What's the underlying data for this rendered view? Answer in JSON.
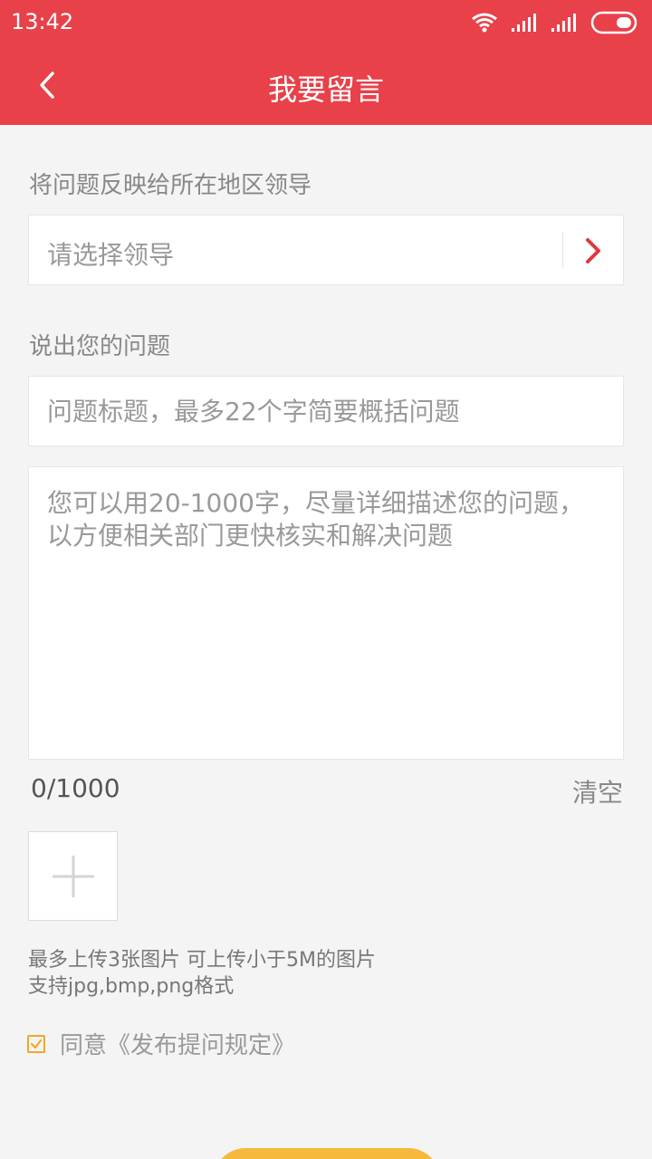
{
  "status_bar": {
    "time": "13:42"
  },
  "header": {
    "title": "我要留言"
  },
  "leader_section": {
    "label": "将问题反映给所在地区领导",
    "select_placeholder": "请选择领导"
  },
  "question_section": {
    "label": "说出您的问题",
    "title_placeholder": "问题标题，最多22个字简要概括问题",
    "content_placeholder": "您可以用20-1000字，尽量详细描述您的问题，以方便相关部门更快核实和解决问题",
    "counter": "0/1000",
    "clear_label": "清空"
  },
  "upload": {
    "hint_line1": "最多上传3张图片 可上传小于5M的图片",
    "hint_line2": "支持jpg,bmp,png格式"
  },
  "agreement": {
    "label": "同意《发布提问规定》",
    "checked": true
  },
  "colors": {
    "brand": "#e8414a",
    "accent": "#f6b93b",
    "checkbox": "#f5a623",
    "chevron": "#e0383e"
  },
  "icons": {
    "back": "chevron-left-icon",
    "select_arrow": "chevron-right-icon",
    "add_photo": "plus-icon",
    "checkbox": "check-icon",
    "wifi": "wifi-icon",
    "signal": "signal-icon",
    "battery": "battery-icon"
  }
}
